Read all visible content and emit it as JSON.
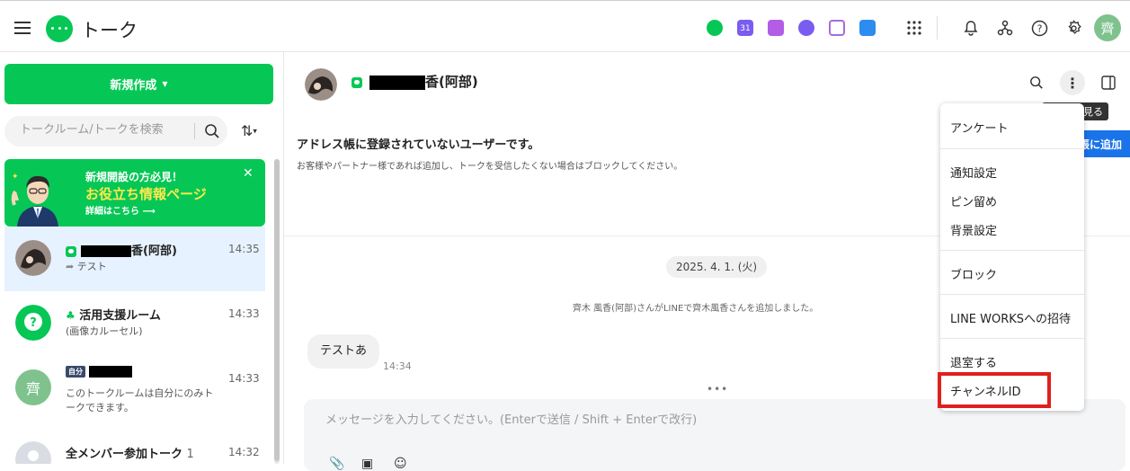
{
  "header": {
    "title": "トーク",
    "app_icons": [
      {
        "name": "talk-app",
        "color": "#06c755"
      },
      {
        "name": "calendar-app",
        "color": "#7b5cf0",
        "label": "31"
      },
      {
        "name": "note-app",
        "color": "#b35ce6"
      },
      {
        "name": "task-app",
        "color": "#7b5cf0"
      },
      {
        "name": "form-app",
        "color": "#a56bde"
      },
      {
        "name": "contacts-app",
        "color": "#2d8cf0"
      }
    ],
    "avatar_initial": "齊"
  },
  "sidebar": {
    "new_button": "新規作成",
    "search_placeholder": "トークルーム/トークを検索",
    "banner": {
      "line1": "新規開設の方必見！",
      "line2": "お役立ち情報ページ",
      "line3": "詳細はこちら ⟶"
    },
    "chats": [
      {
        "name_suffix": "香(阿部)",
        "preview": "テスト",
        "time": "14:35"
      },
      {
        "name": "活用支援ルーム",
        "preview": "(画像カルーセル)",
        "time": "14:33"
      },
      {
        "tag": "自分",
        "preview": "このトークルームは自分にのみト\nークできます。",
        "time": "14:33",
        "avatar_initial": "齊"
      },
      {
        "name": "全メンバー参加トーク",
        "count": "1",
        "time": "14:32"
      }
    ]
  },
  "channel": {
    "name_suffix": "香(阿部)",
    "tooltip": "見る",
    "notice_title": "アドレス帳に登録されていないユーザーです。",
    "notice_body": "お客様やパートナー様であれば追加し、トークを受信したくない場合はブロックしてください。",
    "add_button": "帳に追加",
    "date": "2025. 4. 1. (火)",
    "system_message": "齊木 風香(阿部)さんがLINEで齊木風香さんを追加しました。",
    "message": {
      "text": "テストあ",
      "time": "14:34"
    },
    "composer_placeholder": "メッセージを入力してください。(Enterで送信 / Shift + Enterで改行)"
  },
  "menu": {
    "items": [
      "アンケート",
      "通知設定",
      "ピン留め",
      "背景設定",
      "ブロック",
      "LINE WORKSへの招待",
      "退室する",
      "チャンネルID"
    ]
  },
  "colors": {
    "line_green": "#06c755",
    "highlight_red": "#e0201e",
    "active_row": "#e6f2ff"
  }
}
